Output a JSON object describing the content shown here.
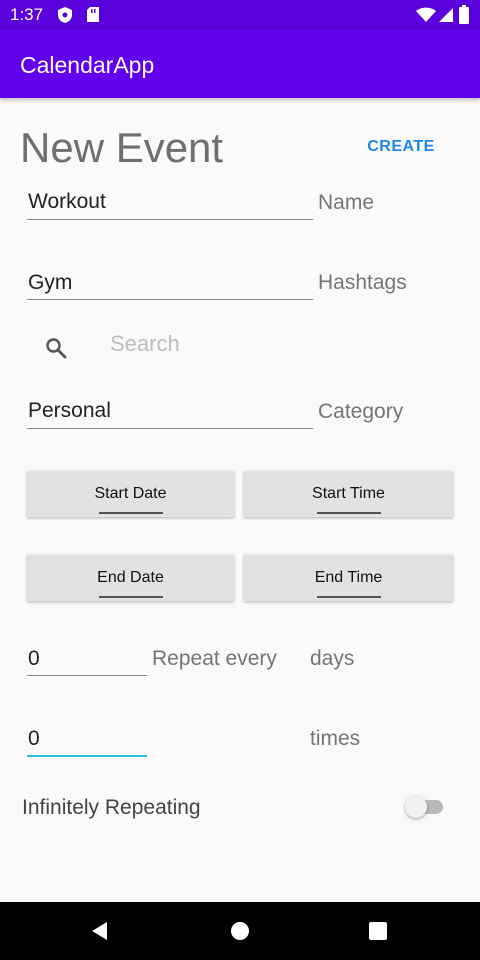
{
  "status_bar": {
    "time": "1:37",
    "icons": [
      "shield-icon",
      "sd-card-icon",
      "wifi-icon",
      "signal-icon",
      "battery-icon"
    ]
  },
  "app_bar": {
    "title": "CalendarApp",
    "color": "#6200ee"
  },
  "form": {
    "title": "New Event",
    "create_label": "CREATE",
    "name": {
      "value": "Workout",
      "label": "Name"
    },
    "hashtags": {
      "value": "Gym",
      "label": "Hashtags"
    },
    "search": {
      "placeholder": "Search"
    },
    "category": {
      "value": "Personal",
      "label": "Category"
    },
    "buttons": {
      "start_date": "Start Date",
      "start_time": "Start Time",
      "end_date": "End Date",
      "end_time": "End Time"
    },
    "repeat_every": {
      "value": "0",
      "label": "Repeat every",
      "unit": "days"
    },
    "repeat_times": {
      "value": "0",
      "unit": "times"
    },
    "infinite": {
      "label": "Infinitely Repeating",
      "enabled": false
    }
  },
  "accent_colors": {
    "create": "#1e88e5",
    "focus_line": "#26c6da"
  },
  "nav_bar": {
    "icons": [
      "back-icon",
      "home-icon",
      "recents-icon"
    ]
  }
}
